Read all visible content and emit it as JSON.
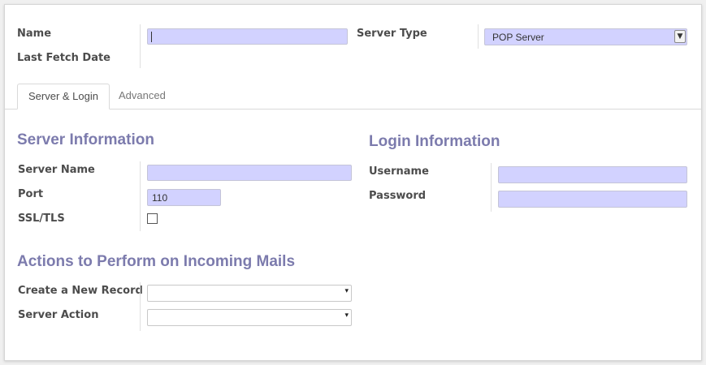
{
  "header": {
    "name_label": "Name",
    "name_value": "",
    "last_fetch_label": "Last Fetch Date",
    "server_type_label": "Server Type",
    "server_type_value": "POP Server"
  },
  "tabs": [
    {
      "label": "Server & Login",
      "active": true
    },
    {
      "label": "Advanced",
      "active": false
    }
  ],
  "server_info": {
    "title": "Server Information",
    "server_name_label": "Server Name",
    "server_name_value": "",
    "port_label": "Port",
    "port_value": "110",
    "ssl_label": "SSL/TLS",
    "ssl_checked": false
  },
  "login_info": {
    "title": "Login Information",
    "username_label": "Username",
    "username_value": "",
    "password_label": "Password",
    "password_value": ""
  },
  "actions": {
    "title": "Actions to Perform on Incoming Mails",
    "create_record_label": "Create a New Record",
    "create_record_value": "",
    "server_action_label": "Server Action",
    "server_action_value": ""
  },
  "icons": {
    "dropdown_arrow": "▾",
    "select_arrow": "▼"
  },
  "colors": {
    "required_field": "#d2d2ff",
    "section_title": "#7c7bad"
  }
}
